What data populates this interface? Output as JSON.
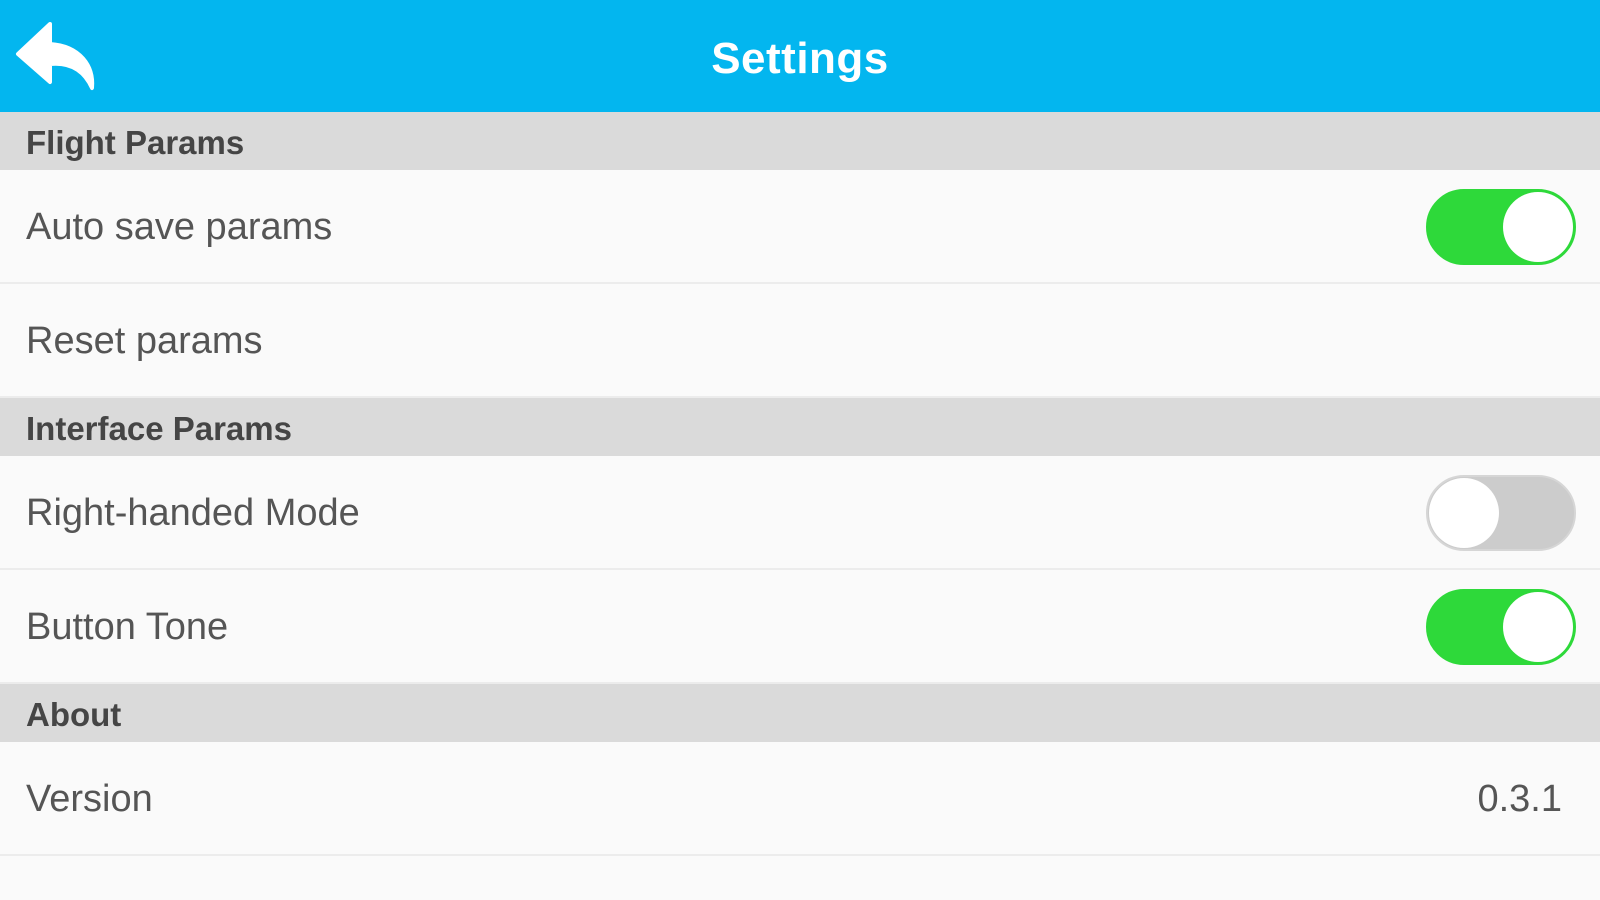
{
  "header": {
    "title": "Settings",
    "back_icon": "back-arrow-icon",
    "color": "#03b6ef"
  },
  "sections": {
    "flight": {
      "title": "Flight Params",
      "auto_save": {
        "label": "Auto save params",
        "enabled": true
      },
      "reset": {
        "label": "Reset params"
      }
    },
    "interface": {
      "title": "Interface Params",
      "right_handed": {
        "label": "Right-handed Mode",
        "enabled": false
      },
      "button_tone": {
        "label": "Button Tone",
        "enabled": true
      }
    },
    "about": {
      "title": "About",
      "version": {
        "label": "Version",
        "value": "0.3.1"
      }
    }
  },
  "colors": {
    "toggle_on": "#2ed93a",
    "toggle_off": "#cccccc",
    "section_bg": "#dadada"
  }
}
